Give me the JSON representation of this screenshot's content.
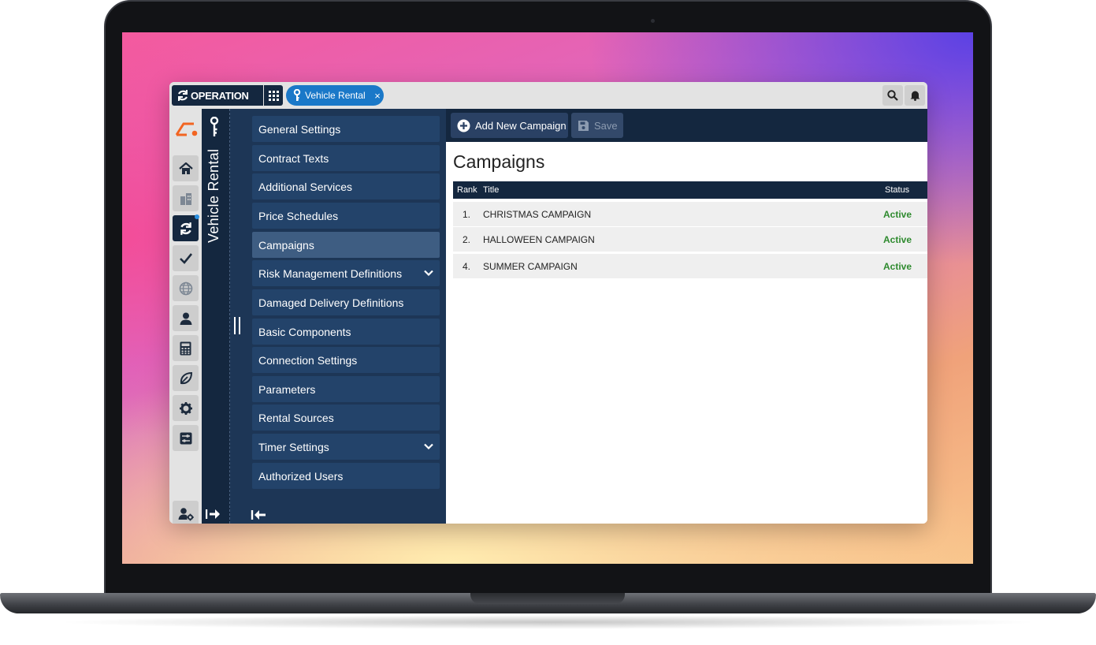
{
  "topbar": {
    "brand": "OPERATION",
    "tab_label": "Vehicle Rental",
    "tab_close": "×"
  },
  "module": {
    "title": "Vehicle Rental"
  },
  "menu": {
    "items": [
      {
        "label": "General Settings"
      },
      {
        "label": "Contract Texts"
      },
      {
        "label": "Additional Services"
      },
      {
        "label": "Price Schedules"
      },
      {
        "label": "Campaigns"
      },
      {
        "label": "Risk Management Definitions"
      },
      {
        "label": "Damaged Delivery Definitions"
      },
      {
        "label": "Basic Components"
      },
      {
        "label": "Connection Settings"
      },
      {
        "label": "Parameters"
      },
      {
        "label": "Rental Sources"
      },
      {
        "label": "Timer Settings"
      },
      {
        "label": "Authorized Users"
      }
    ]
  },
  "toolbar": {
    "add_label": "Add New Campaign",
    "save_label": "Save"
  },
  "page": {
    "title": "Campaigns"
  },
  "table": {
    "columns": {
      "rank": "Rank",
      "title": "Title",
      "status": "Status"
    },
    "rows": [
      {
        "rank": "1.",
        "title": "CHRISTMAS CAMPAIGN",
        "status": "Active"
      },
      {
        "rank": "2.",
        "title": "HALLOWEEN CAMPAIGN",
        "status": "Active"
      },
      {
        "rank": "4.",
        "title": "SUMMER CAMPAIGN",
        "status": "Active"
      }
    ]
  },
  "colors": {
    "navy": "#14273f",
    "menu_bg": "#1d3656",
    "menu_item": "#23436a",
    "menu_active": "#3e5d82",
    "tab_blue": "#1a78c8",
    "status_green": "#2e8a2e",
    "logo_orange": "#f26522"
  },
  "icons": [
    "operation-logo-icon",
    "apps-grid-icon",
    "key-icon",
    "close-icon",
    "search-icon",
    "bell-icon",
    "home-icon",
    "building-icon",
    "sync-icon",
    "check-icon",
    "globe-icon",
    "user-icon",
    "calculator-icon",
    "leaf-icon",
    "gear-icon",
    "sliders-icon",
    "user-settings-icon",
    "chevron-down-icon",
    "plus-circle-icon",
    "save-icon",
    "sign-out-icon",
    "collapse-icon"
  ]
}
